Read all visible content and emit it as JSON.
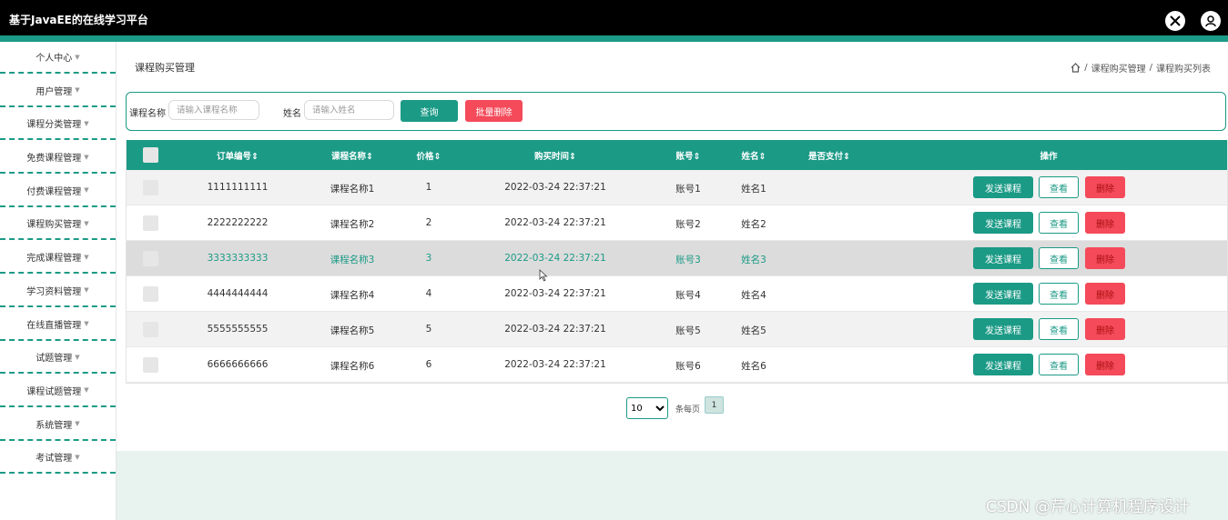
{
  "header": {
    "title": "基于JavaEE的在线学习平台"
  },
  "sidebar": {
    "items": [
      {
        "label": "个人中心"
      },
      {
        "label": "用户管理"
      },
      {
        "label": "课程分类管理"
      },
      {
        "label": "免费课程管理"
      },
      {
        "label": "付费课程管理"
      },
      {
        "label": "课程购买管理"
      },
      {
        "label": "完成课程管理"
      },
      {
        "label": "学习资料管理"
      },
      {
        "label": "在线直播管理"
      },
      {
        "label": "试题管理"
      },
      {
        "label": "课程试题管理"
      },
      {
        "label": "系统管理"
      },
      {
        "label": "考试管理"
      }
    ]
  },
  "page": {
    "title": "课程购买管理"
  },
  "breadcrumb": {
    "level1": "课程购买管理",
    "sep": "/",
    "level2": "课程购买列表"
  },
  "search": {
    "course_label": "课程名称",
    "course_placeholder": "请输入课程名称",
    "name_label": "姓名",
    "name_placeholder": "请输入姓名",
    "query_button": "查询",
    "batch_delete_button": "批量删除"
  },
  "table": {
    "headers": {
      "order_no": "订单编号",
      "course_name": "课程名称",
      "price": "价格",
      "buy_time": "购买时间",
      "account": "账号",
      "name": "姓名",
      "paid": "是否支付",
      "actions": "操作"
    },
    "rows": [
      {
        "order_no": "1111111111",
        "course_name": "课程名称1",
        "price": "1",
        "buy_time": "2022-03-24 22:37:21",
        "account": "账号1",
        "name": "姓名1"
      },
      {
        "order_no": "2222222222",
        "course_name": "课程名称2",
        "price": "2",
        "buy_time": "2022-03-24 22:37:21",
        "account": "账号2",
        "name": "姓名2"
      },
      {
        "order_no": "3333333333",
        "course_name": "课程名称3",
        "price": "3",
        "buy_time": "2022-03-24 22:37:21",
        "account": "账号3",
        "name": "姓名3"
      },
      {
        "order_no": "4444444444",
        "course_name": "课程名称4",
        "price": "4",
        "buy_time": "2022-03-24 22:37:21",
        "account": "账号4",
        "name": "姓名4"
      },
      {
        "order_no": "5555555555",
        "course_name": "课程名称5",
        "price": "5",
        "buy_time": "2022-03-24 22:37:21",
        "account": "账号5",
        "name": "姓名5"
      },
      {
        "order_no": "6666666666",
        "course_name": "课程名称6",
        "price": "6",
        "buy_time": "2022-03-24 22:37:21",
        "account": "账号6",
        "name": "姓名6"
      }
    ],
    "actions": {
      "send": "发送课程",
      "view": "查看",
      "delete": "删除"
    }
  },
  "pagination": {
    "page_size": "10",
    "per_page_label": "条每页",
    "current_page": "1"
  },
  "watermark": "CSDN @芹心计算机程序设计",
  "colors": {
    "accent": "#1b9a86",
    "danger": "#f44a5a",
    "topbar": "#000000"
  },
  "icons": {
    "fullscreen": "fullscreen-exit-icon",
    "user": "user-avatar-icon",
    "home": "home-icon",
    "sort": "sort-icon"
  }
}
